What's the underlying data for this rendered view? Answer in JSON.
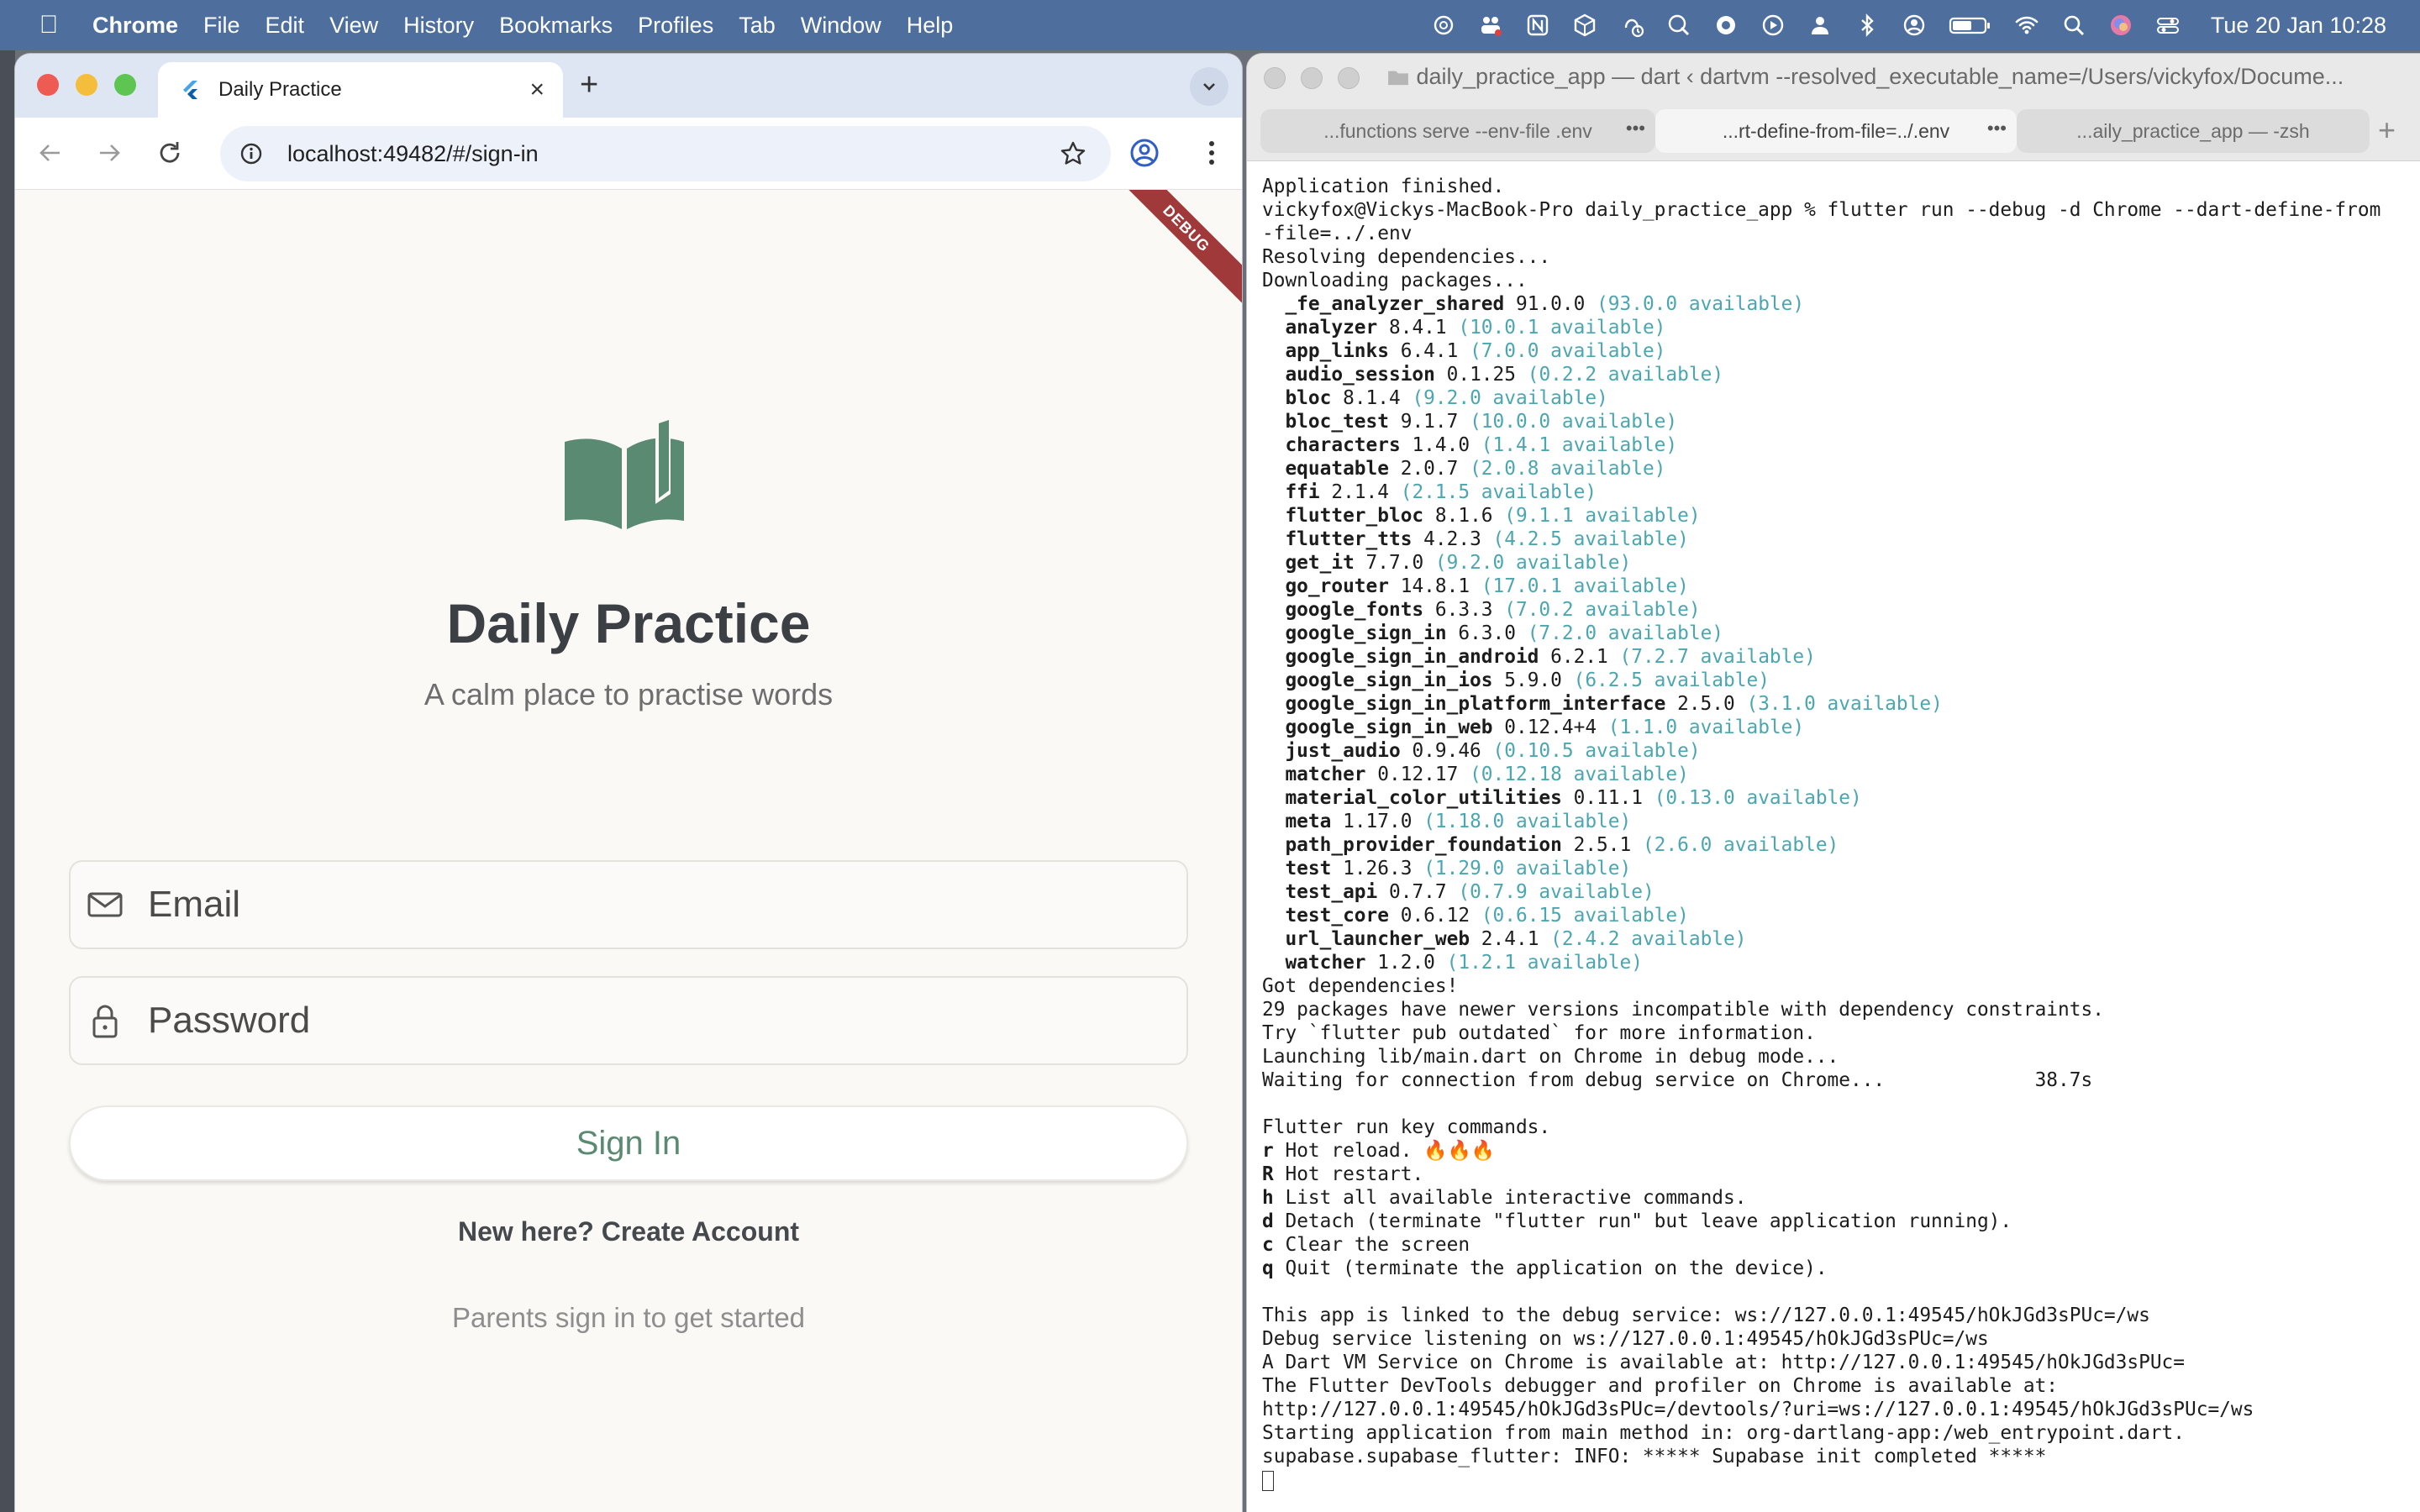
{
  "menubar": {
    "app_name": "Chrome",
    "menus": [
      "File",
      "Edit",
      "View",
      "History",
      "Bookmarks",
      "Profiles",
      "Tab",
      "Window",
      "Help"
    ],
    "clock": "Tue 20 Jan  10:28",
    "status_icons": [
      "chatgpt-icon",
      "people-icon",
      "n-app-icon",
      "cube-icon",
      "finger-scan-icon",
      "pen-icon",
      "gear-flower-icon",
      "play-icon",
      "person-icon",
      "bluetooth-icon",
      "user-circle-icon",
      "battery-icon",
      "wifi-icon",
      "search-icon",
      "siri-icon",
      "control-center-icon"
    ]
  },
  "chrome": {
    "tab_title": "Daily Practice",
    "url": "localhost:49482/#/sign-in"
  },
  "app": {
    "debug_label": "DEBUG",
    "title": "Daily Practice",
    "subtitle": "A calm place to practise words",
    "email_placeholder": "Email",
    "password_placeholder": "Password",
    "sign_in_label": "Sign In",
    "create_account_label": "New here? Create Account",
    "hint": "Parents sign in to get started",
    "accent_color": "#5b8a73"
  },
  "terminal": {
    "window_title": "daily_practice_app — dart ‹ dartvm --resolved_executable_name=/Users/vickyfox/Docume...",
    "tabs": [
      "...functions serve --env-file .env",
      "...rt-define-from-file=../.env",
      "...aily_practice_app — -zsh"
    ],
    "pre_lines": [
      "Application finished.",
      "vickyfox@Vickys-MacBook-Pro daily_practice_app % flutter run --debug -d Chrome --dart-define-from",
      "-file=../.env",
      "Resolving dependencies...",
      "Downloading packages..."
    ],
    "packages": [
      {
        "name": "_fe_analyzer_shared",
        "version": "91.0.0",
        "available": "(93.0.0 available)"
      },
      {
        "name": "analyzer",
        "version": "8.4.1",
        "available": "(10.0.1 available)"
      },
      {
        "name": "app_links",
        "version": "6.4.1",
        "available": "(7.0.0 available)"
      },
      {
        "name": "audio_session",
        "version": "0.1.25",
        "available": "(0.2.2 available)"
      },
      {
        "name": "bloc",
        "version": "8.1.4",
        "available": "(9.2.0 available)"
      },
      {
        "name": "bloc_test",
        "version": "9.1.7",
        "available": "(10.0.0 available)"
      },
      {
        "name": "characters",
        "version": "1.4.0",
        "available": "(1.4.1 available)"
      },
      {
        "name": "equatable",
        "version": "2.0.7",
        "available": "(2.0.8 available)"
      },
      {
        "name": "ffi",
        "version": "2.1.4",
        "available": "(2.1.5 available)"
      },
      {
        "name": "flutter_bloc",
        "version": "8.1.6",
        "available": "(9.1.1 available)"
      },
      {
        "name": "flutter_tts",
        "version": "4.2.3",
        "available": "(4.2.5 available)"
      },
      {
        "name": "get_it",
        "version": "7.7.0",
        "available": "(9.2.0 available)"
      },
      {
        "name": "go_router",
        "version": "14.8.1",
        "available": "(17.0.1 available)"
      },
      {
        "name": "google_fonts",
        "version": "6.3.3",
        "available": "(7.0.2 available)"
      },
      {
        "name": "google_sign_in",
        "version": "6.3.0",
        "available": "(7.2.0 available)"
      },
      {
        "name": "google_sign_in_android",
        "version": "6.2.1",
        "available": "(7.2.7 available)"
      },
      {
        "name": "google_sign_in_ios",
        "version": "5.9.0",
        "available": "(6.2.5 available)"
      },
      {
        "name": "google_sign_in_platform_interface",
        "version": "2.5.0",
        "available": "(3.1.0 available)"
      },
      {
        "name": "google_sign_in_web",
        "version": "0.12.4+4",
        "available": "(1.1.0 available)"
      },
      {
        "name": "just_audio",
        "version": "0.9.46",
        "available": "(0.10.5 available)"
      },
      {
        "name": "matcher",
        "version": "0.12.17",
        "available": "(0.12.18 available)"
      },
      {
        "name": "material_color_utilities",
        "version": "0.11.1",
        "available": "(0.13.0 available)"
      },
      {
        "name": "meta",
        "version": "1.17.0",
        "available": "(1.18.0 available)"
      },
      {
        "name": "path_provider_foundation",
        "version": "2.5.1",
        "available": "(2.6.0 available)"
      },
      {
        "name": "test",
        "version": "1.26.3",
        "available": "(1.29.0 available)"
      },
      {
        "name": "test_api",
        "version": "0.7.7",
        "available": "(0.7.9 available)"
      },
      {
        "name": "test_core",
        "version": "0.6.12",
        "available": "(0.6.15 available)"
      },
      {
        "name": "url_launcher_web",
        "version": "2.4.1",
        "available": "(2.4.2 available)"
      },
      {
        "name": "watcher",
        "version": "1.2.0",
        "available": "(1.2.1 available)"
      }
    ],
    "mid_lines": [
      "Got dependencies!",
      "29 packages have newer versions incompatible with dependency constraints.",
      "Try `flutter pub outdated` for more information.",
      "Launching lib/main.dart on Chrome in debug mode...",
      "Waiting for connection from debug service on Chrome...             38.7s",
      "",
      "Flutter run key commands."
    ],
    "key_commands": [
      {
        "key": "r",
        "text": "Hot reload. 🔥🔥🔥"
      },
      {
        "key": "R",
        "text": "Hot restart."
      },
      {
        "key": "h",
        "text": "List all available interactive commands."
      },
      {
        "key": "d",
        "text": "Detach (terminate \"flutter run\" but leave application running)."
      },
      {
        "key": "c",
        "text": "Clear the screen"
      },
      {
        "key": "q",
        "text": "Quit (terminate the application on the device)."
      }
    ],
    "post_lines": [
      "",
      "This app is linked to the debug service: ws://127.0.0.1:49545/hOkJGd3sPUc=/ws",
      "Debug service listening on ws://127.0.0.1:49545/hOkJGd3sPUc=/ws",
      "A Dart VM Service on Chrome is available at: http://127.0.0.1:49545/hOkJGd3sPUc=",
      "The Flutter DevTools debugger and profiler on Chrome is available at:",
      "http://127.0.0.1:49545/hOkJGd3sPUc=/devtools/?uri=ws://127.0.0.1:49545/hOkJGd3sPUc=/ws",
      "Starting application from main method in: org-dartlang-app:/web_entrypoint.dart.",
      "supabase.supabase_flutter: INFO: ***** Supabase init completed *****"
    ]
  }
}
